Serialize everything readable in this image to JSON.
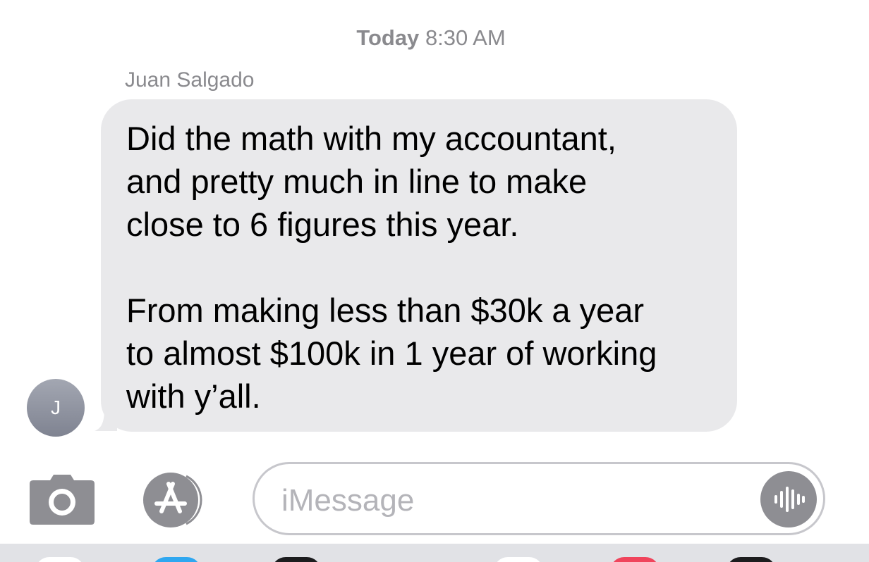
{
  "header": {
    "timestamp_day": "Today",
    "timestamp_time": "8:30 AM"
  },
  "conversation": {
    "sender_name": "Juan Salgado",
    "avatar_initial": "J",
    "message": {
      "paragraph1": [
        "Did the math with my accountant,",
        "and pretty much in line to make",
        "close to 6 figures this year."
      ],
      "paragraph2": [
        "From making less than $30k a year",
        "to almost $100k in 1 year of working",
        "with y’all."
      ]
    }
  },
  "input_bar": {
    "placeholder": "iMessage",
    "camera_icon": "camera-icon",
    "app_store_icon": "app-store-icon",
    "audio_icon": "audio-waveform-icon"
  },
  "app_tray": {
    "icons": [
      "app-icon",
      "app-icon",
      "app-icon",
      "app-icon",
      "app-icon",
      "app-icon"
    ],
    "colors": [
      "#ffffff",
      "#2fa7f0",
      "#1c1c1e",
      "#ffffff",
      "#f0445c",
      "#1c1c1e"
    ]
  },
  "colors": {
    "bubble_incoming": "#e9e9eb",
    "secondary_text": "#8a8a8e",
    "button_gray": "#8e8e93"
  }
}
